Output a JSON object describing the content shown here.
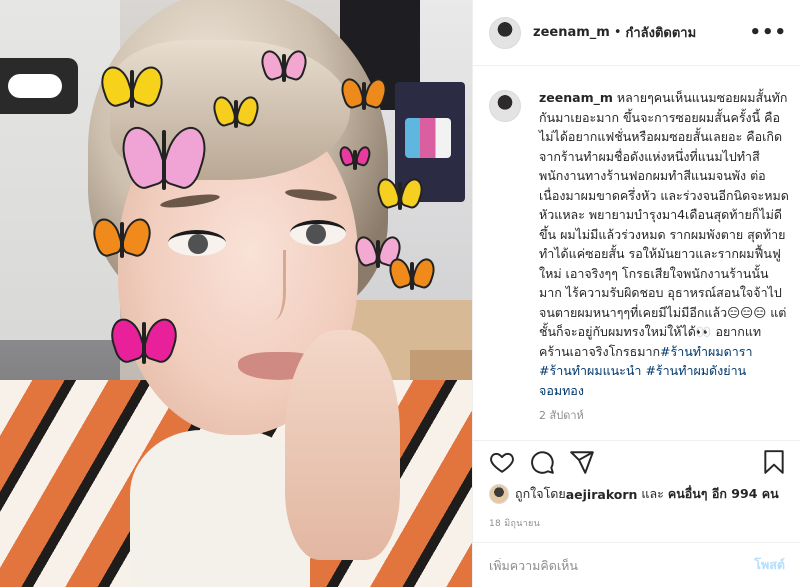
{
  "post": {
    "username": "zeenam_m",
    "follow_status": "กำลังติดตาม",
    "more_icon": "more-horizontal-icon",
    "caption_user": "zeenam_m",
    "caption_body": " หลายๆคนเห็นแนมซอยผมสั้นทักกันมาเยอะมาก ขึ้นจะการซอยผมสั้นครั้งนี้ คือไม่ได้อยากแฟชั่นหรือผมซอยสั้นเลยอะ คือเกิดจากร้านทำผมชื่อดังแห่งหนึ่งที่แนมไปทำสี พนักงานทางร้านฟอกผมทำสีแนมจนพัง ต่อเนื่องมาผมขาดครึ่งหัว และร่วงจนอีกนิดจะหมดหัวแหละ พยายามบำรุงมา4เดือนสุดท้ายก็ไม่ดีขึ้น ผมไม่มีแล้วร่วงหมด รากผมพังตาย สุดท้ายทำได้แค่ซอยสั้น รอให้มันยาวและรากผมฟื้นฟูใหม่ เอาจริงๆๆ โกรธเสียใจพนักงานร้านนั้นมาก ไร้ความรับผิดชอบ อุธาหรณ์สอนใจจ้าไปจนตายผมหนาๆๆที่เคยมีไม่มีอีกแล้ว😑😑😑 แต่ชั้นก็จะอยู่กับผมทรงใหม่ให้ได้👀 อยากแทคร้านเอาจริงโกรธมาก",
    "hashtags": [
      "#ร้านทำผมดารา",
      "#ร้านทำผมแนะนำ",
      "#ร้านทำผมดังย่านจอมทอง"
    ],
    "time_ago": "2 สัปดาห์",
    "likes_prefix": "ถูกใจโดย ",
    "likes_user": "aejirakorn",
    "likes_and": " และ ",
    "likes_others": "คนอื่นๆ อีก 994 คน",
    "date": "18 มิถุนายน",
    "comment_placeholder": "เพิ่มความคิดเห็น",
    "post_label": "โพสต์"
  },
  "icons": {
    "like": "heart-icon",
    "comment": "comment-icon",
    "share": "share-icon",
    "save": "bookmark-icon"
  },
  "colors": {
    "link": "#00376b",
    "muted": "#8e8e8e",
    "post_button_disabled": "#b2dffc",
    "border": "#efefef"
  }
}
